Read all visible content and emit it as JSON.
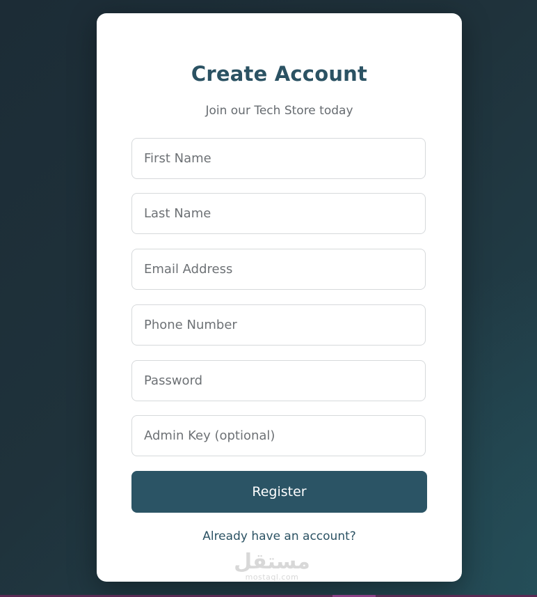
{
  "form": {
    "title": "Create Account",
    "subtitle": "Join our Tech Store today",
    "fields": {
      "first_name": {
        "placeholder": "First Name"
      },
      "last_name": {
        "placeholder": "Last Name"
      },
      "email": {
        "placeholder": "Email Address"
      },
      "phone": {
        "placeholder": "Phone Number"
      },
      "password": {
        "placeholder": "Password"
      },
      "admin_key": {
        "placeholder": "Admin Key (optional)"
      }
    },
    "submit_label": "Register",
    "login_link": "Already have an account?"
  },
  "watermark": {
    "arabic": "مستقل",
    "latin": "mostaql.com"
  },
  "colors": {
    "accent": "#2b5465",
    "title": "#2b5263",
    "card": "#ffffff",
    "background": "#1f323b"
  }
}
